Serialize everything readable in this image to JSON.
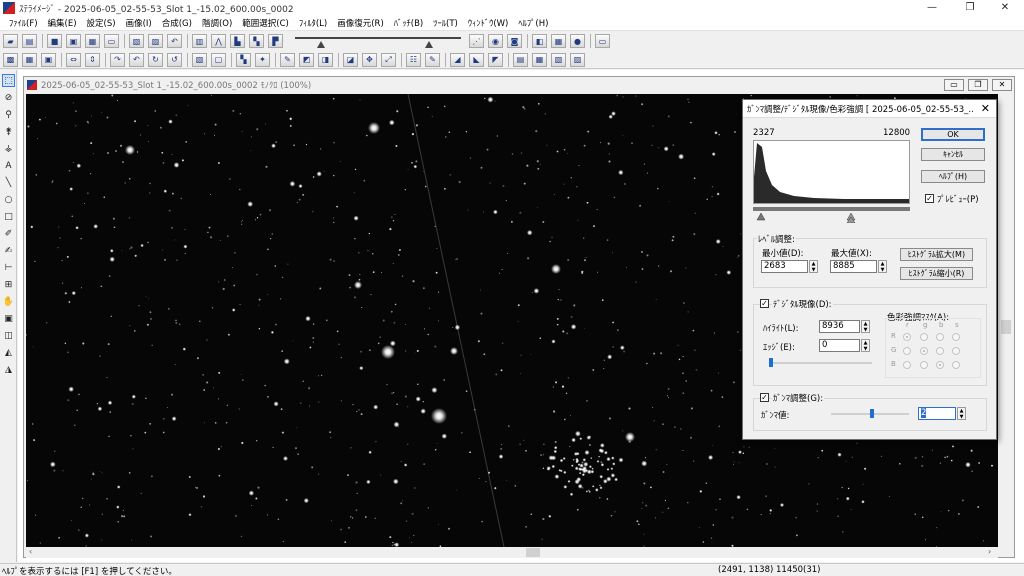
{
  "app": {
    "title": "ｽﾃﾗｲﾒｰｼﾞ - 2025-06-05_02-55-53_Slot 1_-15.02_600.00s_0002"
  },
  "window_controls": {
    "minimize": "—",
    "restore": "❐",
    "close": "✕"
  },
  "menu": [
    "ﾌｧｲﾙ(F)",
    "編集(E)",
    "設定(S)",
    "画像(I)",
    "合成(G)",
    "階調(O)",
    "範囲選択(C)",
    "ﾌｨﾙﾀ(L)",
    "画像復元(R)",
    "ﾊﾞｯﾁ(B)",
    "ﾂｰﾙ(T)",
    "ｳｨﾝﾄﾞｳ(W)",
    "ﾍﾙﾌﾟ(H)"
  ],
  "image_window": {
    "title": "2025-06-05_02-55-53_Slot 1_-15.02_600.00s_0002 ﾓﾉｸﾛ (100%)"
  },
  "dialog": {
    "title": "ｶﾞﾝﾏ調整/ﾃﾞｼﾞﾀﾙ現像/色彩強調 [ 2025-06-05_02-55-53_...",
    "hist_min": "2327",
    "hist_max": "12800",
    "ok_label": "OK",
    "cancel_label": "ｷｬﾝｾﾙ",
    "help_label": "ﾍﾙﾌﾟ(H)",
    "preview_label": "ﾌﾟﾚﾋﾞｭｰ(P)",
    "level_group_label": "ﾚﾍﾞﾙ調整:",
    "min_label": "最小値(D):",
    "max_label": "最大値(X):",
    "min_value": "2683",
    "max_value": "8885",
    "hist_expand_label": "ﾋｽﾄｸﾞﾗﾑ拡大(M)",
    "hist_shrink_label": "ﾋｽﾄｸﾞﾗﾑ縮小(R)",
    "ddp_label": "ﾃﾞｼﾞﾀﾙ現像(D):",
    "highlight_label": "ﾊｲﾗｲﾄ(L):",
    "highlight_value": "8936",
    "edge_label": "ｴｯｼﾞ(E):",
    "edge_value": "0",
    "mask_label": "色彩強調ﾏｽｸ(A):",
    "mask_cols": [
      "r",
      "g",
      "b",
      "s"
    ],
    "mask_rows": [
      "R",
      "G",
      "B"
    ],
    "gamma_group_label": "ｶﾞﾝﾏ調整(G):",
    "gamma_label": "ｶﾞﾝﾏ値:",
    "gamma_value": "2"
  },
  "statusbar": {
    "help": "ﾍﾙﾌﾟを表示するには [F1] を押してください。",
    "coords": "(2491, 1138) 11450(31)"
  }
}
